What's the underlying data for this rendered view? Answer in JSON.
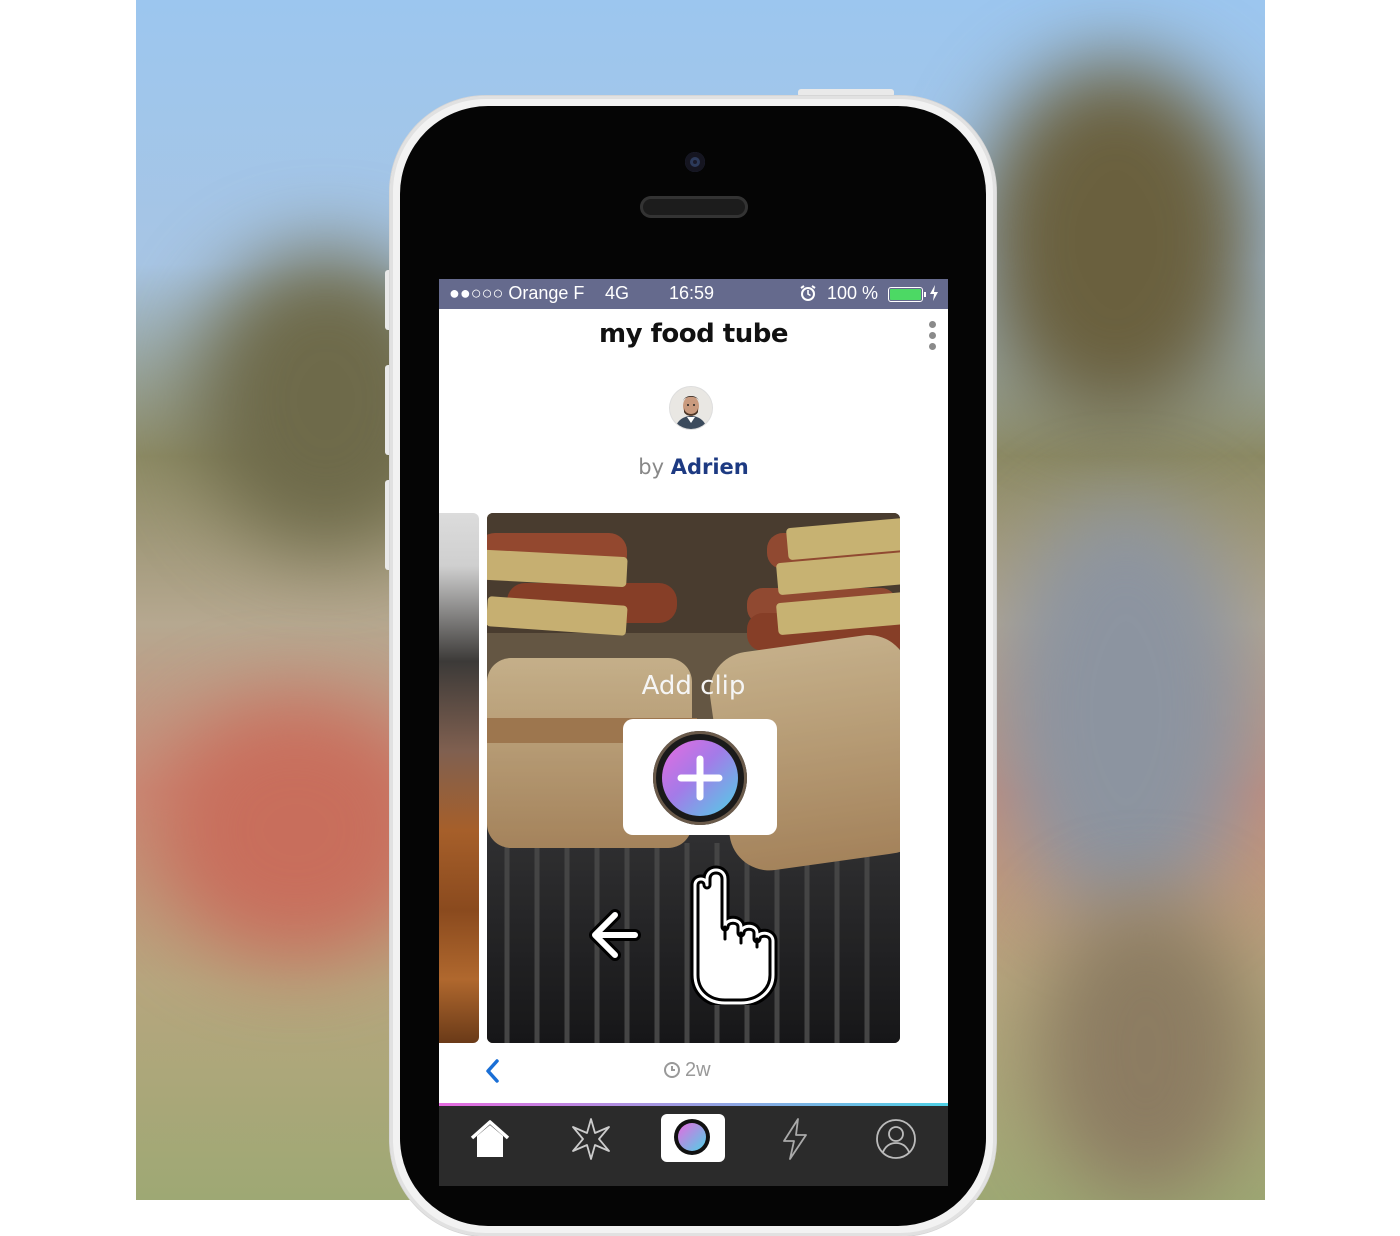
{
  "status_bar": {
    "carrier": "●●○○○ Orange F",
    "network": "4G",
    "time": "16:59",
    "battery": "100 %",
    "battery_level": 1.0
  },
  "header": {
    "title": "my food tube"
  },
  "author": {
    "prefix": "by",
    "name": "Adrien"
  },
  "clip_card": {
    "add_label": "Add clip"
  },
  "meta": {
    "age": "2w"
  },
  "tabbar": {
    "items": [
      "home-icon",
      "explore-star-icon",
      "camera-record-icon",
      "activity-bolt-icon",
      "profile-icon"
    ],
    "active": "camera-record-icon"
  },
  "colors": {
    "status_bar": "#656a8d",
    "author_name": "#1d3a82",
    "link_blue": "#1a6fd6",
    "tabbar": "#2b2b2b",
    "gradient_start": "#e66be0",
    "gradient_end": "#4fd1e6"
  }
}
